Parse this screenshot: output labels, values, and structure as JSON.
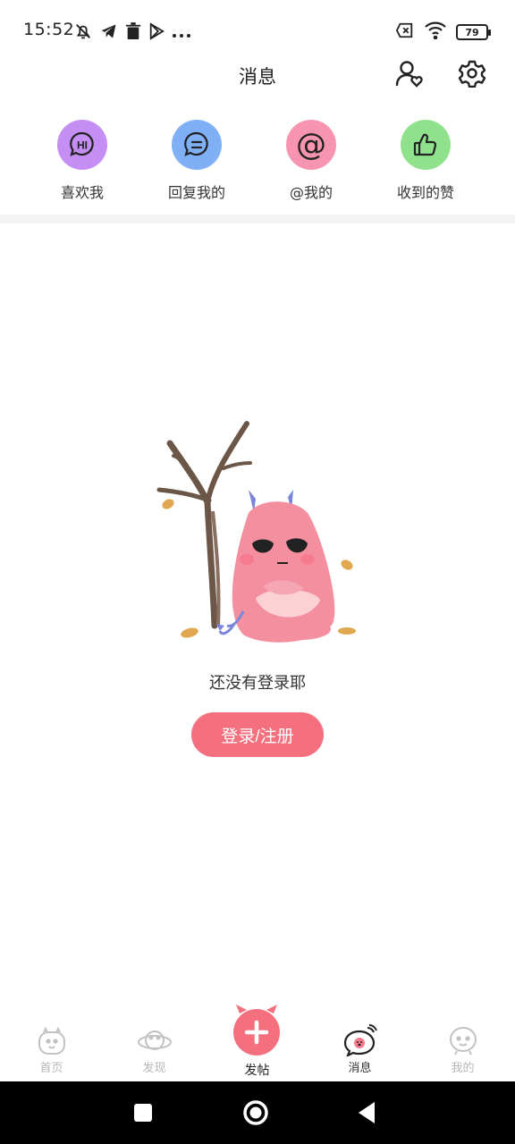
{
  "status_bar": {
    "time": "15:52",
    "battery": "79",
    "left_icons": [
      "mute-bell-icon",
      "telegram-icon",
      "trash-icon",
      "play-store-icon",
      "more-dots-icon"
    ],
    "right_icons": [
      "sim-off-icon",
      "wifi-icon",
      "battery-icon"
    ]
  },
  "header": {
    "title": "消息",
    "left_action_icon": "user-heart-icon",
    "right_action_icon": "gear-icon"
  },
  "quick_actions": [
    {
      "label": "喜欢我",
      "icon": "hi-bubble-icon",
      "color": "#c58ef5",
      "glyph": "HI"
    },
    {
      "label": "回复我的",
      "icon": "comment-bubble-icon",
      "color": "#7fb0f6"
    },
    {
      "label": "@我的",
      "icon": "at-icon",
      "color": "#f794b2",
      "glyph": "@"
    },
    {
      "label": "收到的赞",
      "icon": "thumbs-up-icon",
      "color": "#8fe28b"
    }
  ],
  "empty_state": {
    "message": "还没有登录耶",
    "login_button": "登录/注册"
  },
  "bottom_nav": {
    "items": [
      {
        "label": "首页",
        "icon": "home-monster-icon",
        "active": false
      },
      {
        "label": "发现",
        "icon": "planet-icon",
        "active": false
      },
      {
        "label": "发帖",
        "icon": "plus-icon",
        "active": true
      },
      {
        "label": "消息",
        "icon": "message-monster-icon",
        "active": true
      },
      {
        "label": "我的",
        "icon": "profile-face-icon",
        "active": false
      }
    ]
  },
  "colors": {
    "accent": "#f4707e",
    "text": "#222222",
    "muted": "#b7b7b7"
  }
}
